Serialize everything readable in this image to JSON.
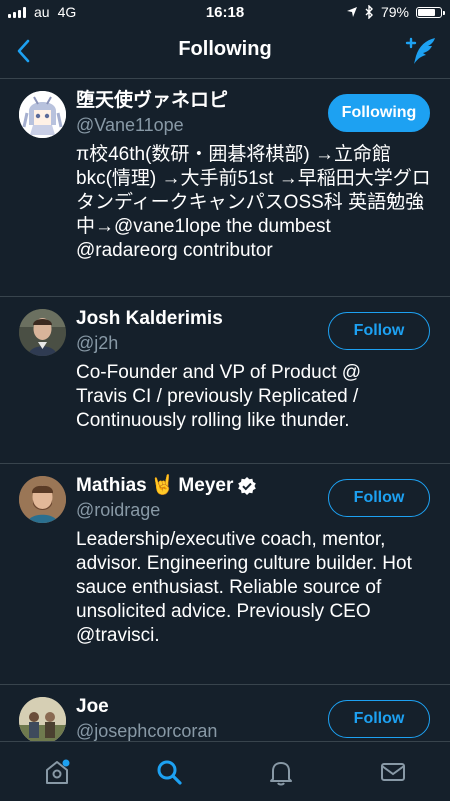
{
  "status": {
    "carrier": "au",
    "network": "4G",
    "time": "16:18",
    "battery": "79%",
    "battery_level": 0.79
  },
  "nav": {
    "title": "Following"
  },
  "users": [
    {
      "name": "堕天使ヴァネロピ",
      "handle": "@Vane11ope",
      "bio": "π校46th(数研・囲碁将棋部) →立命館bkc(情理) →大手前51st →早稲田大学グロタンディークキャンパスOSS科 英語勉強中→@vane1lope the dumbest @radareorg contributor",
      "button": "Following"
    },
    {
      "name": "Josh Kalderimis",
      "handle": "@j2h",
      "bio": "Co-Founder and VP of Product @ Travis CI / previously Replicated / Continuously rolling like thunder.",
      "button": "Follow"
    },
    {
      "name_before": "Mathias",
      "name_emoji": "🤘",
      "name_after": "Meyer",
      "handle": "@roidrage",
      "bio": "Leadership/executive coach, mentor, advisor. Engineering culture builder. Hot sauce enthusiast. Reliable source of unsolicited advice. Previously CEO @travisci.",
      "button": "Follow"
    },
    {
      "name": "Joe",
      "handle": "@josephcorcoran",
      "button": "Follow"
    }
  ],
  "colors": {
    "background": "#15202b",
    "accent": "#1da1f2",
    "secondary_text": "#8899a6",
    "divider": "#38444d"
  },
  "icons": {
    "back": "chevron-left-icon",
    "compose": "compose-feather-icon",
    "verified": "verified-badge-icon",
    "tabs": [
      "home-icon",
      "search-icon",
      "notifications-bell-icon",
      "messages-mail-icon"
    ]
  }
}
